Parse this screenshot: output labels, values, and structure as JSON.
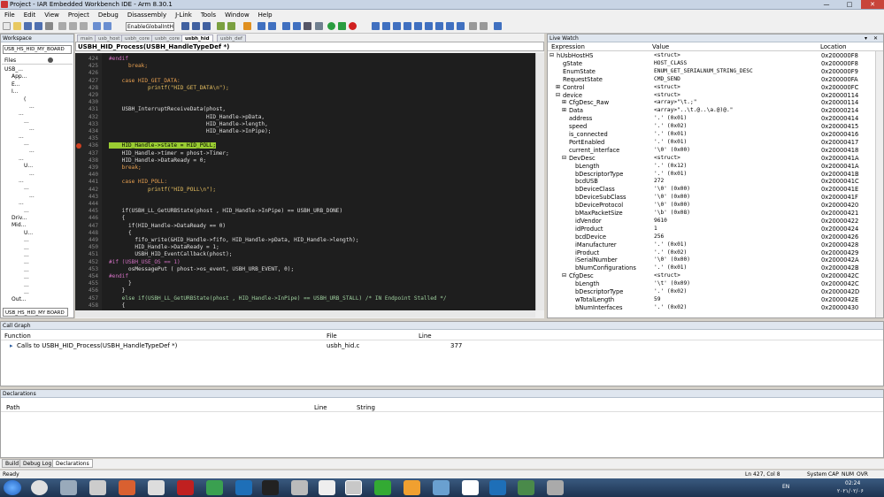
{
  "window": {
    "title": "Project - IAR Embedded Workbench IDE - Arm 8.30.1"
  },
  "menu": [
    "File",
    "Edit",
    "View",
    "Project",
    "Debug",
    "Disassembly",
    "J-Link",
    "Tools",
    "Window",
    "Help"
  ],
  "toolbar": {
    "config_select": "EnableGlobalIntHE"
  },
  "workspace": {
    "title": "Workspace",
    "config": "USB_HS_HID_MY_BOARD",
    "files_label": "Files",
    "tree": [
      "USB_...",
      "App...",
      "E...",
      "I...",
      "(",
      "...",
      "...",
      "...",
      "...",
      "...",
      "...",
      "...",
      "...",
      "U...",
      "...",
      "...",
      "...",
      "...",
      "...",
      "...",
      "Driv...",
      "Mid...",
      "U...",
      "...",
      "...",
      "...",
      "...",
      "...",
      "...",
      "...",
      "...",
      "Out..."
    ],
    "bottom_tab": "USB_HS_HID_MY BOARD"
  },
  "editor": {
    "tabs": [
      "main",
      "usb_host",
      "usbh_core",
      "usbh_core",
      "usbh_hid",
      "usbh_def"
    ],
    "active_tab": "usbh_hid",
    "function_bar": "USBH_HID_Process(USBH_HandleTypeDef *)",
    "lines": [
      {
        "n": "424",
        "t": "#endif",
        "c": "pp"
      },
      {
        "n": "425",
        "t": "      break;",
        "c": "kw"
      },
      {
        "n": "426",
        "t": "",
        "c": ""
      },
      {
        "n": "427",
        "t": "    case HID_GET_DATA:",
        "c": "kw"
      },
      {
        "n": "428",
        "t": "            printf(\"HID_GET_DATA\\n\");",
        "c": "str"
      },
      {
        "n": "429",
        "t": "",
        "c": ""
      },
      {
        "n": "430",
        "t": "",
        "c": ""
      },
      {
        "n": "431",
        "t": "    USBH_InterruptReceiveData(phost,",
        "c": ""
      },
      {
        "n": "432",
        "t": "                              HID_Handle->pData,",
        "c": ""
      },
      {
        "n": "433",
        "t": "                              HID_Handle->length,",
        "c": ""
      },
      {
        "n": "434",
        "t": "                              HID_Handle->InPipe);",
        "c": ""
      },
      {
        "n": "435",
        "t": "",
        "c": ""
      },
      {
        "n": "436",
        "t": "    HID_Handle->state = HID_POLL;",
        "c": "hl"
      },
      {
        "n": "437",
        "t": "    HID_Handle->timer = phost->Timer;",
        "c": ""
      },
      {
        "n": "438",
        "t": "    HID_Handle->DataReady = 0;",
        "c": ""
      },
      {
        "n": "439",
        "t": "    break;",
        "c": "kw"
      },
      {
        "n": "440",
        "t": "",
        "c": ""
      },
      {
        "n": "441",
        "t": "    case HID_POLL:",
        "c": "kw"
      },
      {
        "n": "442",
        "t": "            printf(\"HID_POLL\\n\");",
        "c": "str"
      },
      {
        "n": "443",
        "t": "",
        "c": ""
      },
      {
        "n": "444",
        "t": "",
        "c": ""
      },
      {
        "n": "445",
        "t": "    if(USBH_LL_GetURBState(phost , HID_Handle->InPipe) == USBH_URB_DONE)",
        "c": ""
      },
      {
        "n": "446",
        "t": "    {",
        "c": ""
      },
      {
        "n": "447",
        "t": "      if(HID_Handle->DataReady == 0)",
        "c": ""
      },
      {
        "n": "448",
        "t": "      {",
        "c": ""
      },
      {
        "n": "449",
        "t": "        fifo_write(&HID_Handle->fifo, HID_Handle->pData, HID_Handle->length);",
        "c": ""
      },
      {
        "n": "450",
        "t": "        HID_Handle->DataReady = 1;",
        "c": ""
      },
      {
        "n": "451",
        "t": "        USBH_HID_EventCallback(phost);",
        "c": ""
      },
      {
        "n": "452",
        "t": "#if (USBH_USE_OS == 1)",
        "c": "pp"
      },
      {
        "n": "453",
        "t": "      osMessagePut ( phost->os_event, USBH_URB_EVENT, 0);",
        "c": ""
      },
      {
        "n": "454",
        "t": "#endif",
        "c": "pp"
      },
      {
        "n": "455",
        "t": "      }",
        "c": ""
      },
      {
        "n": "456",
        "t": "    }",
        "c": ""
      },
      {
        "n": "457",
        "t": "    else if(USBH_LL_GetURBState(phost , HID_Handle->InPipe) == USBH_URB_STALL) /* IN Endpoint Stalled */",
        "c": "cmt"
      },
      {
        "n": "458",
        "t": "    {",
        "c": ""
      }
    ]
  },
  "live_watch": {
    "title": "Live Watch",
    "columns": [
      "Expression",
      "Value",
      "Location"
    ],
    "rows": [
      {
        "e": "hUsbHostHS",
        "v": "<struct>",
        "l": "0x200000F8",
        "i": 0,
        "x": "⊟"
      },
      {
        "e": "gState",
        "v": "HOST_CLASS",
        "l": "0x200000F8",
        "i": 1,
        "x": ""
      },
      {
        "e": "EnumState",
        "v": "ENUM_GET_SERIALNUM_STRING_DESC",
        "l": "0x200000F9",
        "i": 1,
        "x": ""
      },
      {
        "e": "RequestState",
        "v": "CMD_SEND",
        "l": "0x200000FA",
        "i": 1,
        "x": ""
      },
      {
        "e": "Control",
        "v": "<struct>",
        "l": "0x200000FC",
        "i": 1,
        "x": "⊞"
      },
      {
        "e": "device",
        "v": "<struct>",
        "l": "0x20000114",
        "i": 1,
        "x": "⊟"
      },
      {
        "e": "CfgDesc_Raw",
        "v": "<array>\"\\t.;\"",
        "l": "0x20000114",
        "i": 2,
        "x": "⊞"
      },
      {
        "e": "Data",
        "v": "<array>\"..\\t.@..\\a.@)@.\"",
        "l": "0x20000214",
        "i": 2,
        "x": "⊞"
      },
      {
        "e": "address",
        "v": "'.' (0x01)",
        "l": "0x20000414",
        "i": 2,
        "x": ""
      },
      {
        "e": "speed",
        "v": "'.' (0x02)",
        "l": "0x20000415",
        "i": 2,
        "x": ""
      },
      {
        "e": "is_connected",
        "v": "'.' (0x01)",
        "l": "0x20000416",
        "i": 2,
        "x": ""
      },
      {
        "e": "PortEnabled",
        "v": "'.' (0x01)",
        "l": "0x20000417",
        "i": 2,
        "x": ""
      },
      {
        "e": "current_interface",
        "v": "'\\0' (0x00)",
        "l": "0x20000418",
        "i": 2,
        "x": ""
      },
      {
        "e": "DevDesc",
        "v": "<struct>",
        "l": "0x2000041A",
        "i": 2,
        "x": "⊟"
      },
      {
        "e": "bLength",
        "v": "'.' (0x12)",
        "l": "0x2000041A",
        "i": 3,
        "x": ""
      },
      {
        "e": "bDescriptorType",
        "v": "'.' (0x01)",
        "l": "0x2000041B",
        "i": 3,
        "x": ""
      },
      {
        "e": "bcdUSB",
        "v": "272",
        "l": "0x2000041C",
        "i": 3,
        "x": ""
      },
      {
        "e": "bDeviceClass",
        "v": "'\\0' (0x00)",
        "l": "0x2000041E",
        "i": 3,
        "x": ""
      },
      {
        "e": "bDeviceSubClass",
        "v": "'\\0' (0x00)",
        "l": "0x2000041F",
        "i": 3,
        "x": ""
      },
      {
        "e": "bDeviceProtocol",
        "v": "'\\0' (0x00)",
        "l": "0x20000420",
        "i": 3,
        "x": ""
      },
      {
        "e": "bMaxPacketSize",
        "v": "'\\b' (0x08)",
        "l": "0x20000421",
        "i": 3,
        "x": ""
      },
      {
        "e": "idVendor",
        "v": "9610",
        "l": "0x20000422",
        "i": 3,
        "x": ""
      },
      {
        "e": "idProduct",
        "v": "1",
        "l": "0x20000424",
        "i": 3,
        "x": ""
      },
      {
        "e": "bcdDevice",
        "v": "256",
        "l": "0x20000426",
        "i": 3,
        "x": ""
      },
      {
        "e": "iManufacturer",
        "v": "'.' (0x01)",
        "l": "0x20000428",
        "i": 3,
        "x": ""
      },
      {
        "e": "iProduct",
        "v": "'.' (0x02)",
        "l": "0x20000429",
        "i": 3,
        "x": ""
      },
      {
        "e": "iSerialNumber",
        "v": "'\\0' (0x00)",
        "l": "0x2000042A",
        "i": 3,
        "x": ""
      },
      {
        "e": "bNumConfigurations",
        "v": "'.' (0x01)",
        "l": "0x2000042B",
        "i": 3,
        "x": ""
      },
      {
        "e": "CfgDesc",
        "v": "<struct>",
        "l": "0x2000042C",
        "i": 2,
        "x": "⊟"
      },
      {
        "e": "bLength",
        "v": "'\\t' (0x09)",
        "l": "0x2000042C",
        "i": 3,
        "x": ""
      },
      {
        "e": "bDescriptorType",
        "v": "'.' (0x02)",
        "l": "0x2000042D",
        "i": 3,
        "x": ""
      },
      {
        "e": "wTotalLength",
        "v": "59",
        "l": "0x2000042E",
        "i": 3,
        "x": ""
      },
      {
        "e": "bNumInterfaces",
        "v": "'.' (0x02)",
        "l": "0x20000430",
        "i": 3,
        "x": ""
      }
    ]
  },
  "call_graph": {
    "title": "Call Graph",
    "columns": [
      "Function",
      "File",
      "Line"
    ],
    "rows": [
      {
        "f": "Calls to USBH_HID_Process(USBH_HandleTypeDef *)",
        "file": "usbh_hid.c",
        "line": "377"
      }
    ]
  },
  "declarations": {
    "title": "Declarations",
    "columns": [
      "Path",
      "Line",
      "String"
    ]
  },
  "bottom_tabs": [
    "Build",
    "Debug Log",
    "Declarations"
  ],
  "status": {
    "left": "Ready",
    "pos": "Ln 427, Col 8",
    "enc": "System",
    "caps": "CAP",
    "num": "NUM",
    "ovr": "OVR"
  },
  "taskbar": {
    "lang": "EN",
    "time": "02:24",
    "date": "۲۰۲۱/۰۲/۰۶"
  },
  "colors": {
    "accent": "#3399ff",
    "code_bg": "#1e1e1e",
    "highlight": "#9acd32",
    "taskbar": "#1d3350"
  }
}
